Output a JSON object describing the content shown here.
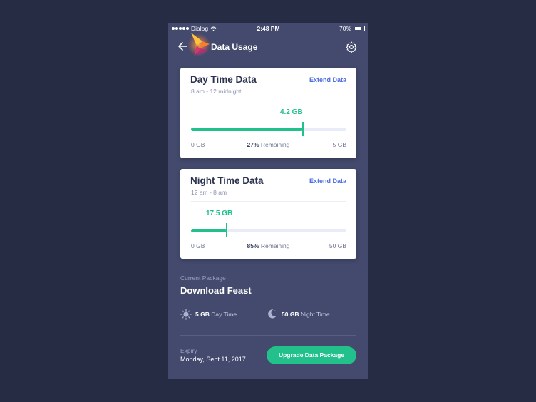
{
  "status_bar": {
    "carrier": "Dialog",
    "time": "2:48 PM",
    "battery": "70%"
  },
  "header": {
    "title": "Data Usage"
  },
  "day_card": {
    "title": "Day Time Data",
    "hours": "8 am - 12 midnight",
    "extend_label": "Extend Data",
    "used": "4.2 GB",
    "used_fraction": 0.72,
    "min_label": "0 GB",
    "remaining_pct": "27%",
    "remaining_word": "Remaining",
    "max_label": "5 GB"
  },
  "night_card": {
    "title": "Night Time Data",
    "hours": "12 am - 8 am",
    "extend_label": "Extend Data",
    "used": "17.5 GB",
    "used_fraction": 0.23,
    "min_label": "0 GB",
    "remaining_pct": "85%",
    "remaining_word": "Remaining",
    "max_label": "50 GB"
  },
  "package": {
    "label": "Current Package",
    "name": "Download Feast",
    "day_amount": "5 GB",
    "day_text": "Day Time",
    "night_amount": "50 GB",
    "night_text": "Night Time"
  },
  "expiry": {
    "label": "Expiry",
    "date": "Monday, Sept 11, 2017"
  },
  "actions": {
    "upgrade_label": "Upgrade Data Package"
  },
  "colors": {
    "accent_green": "#22c18b",
    "link_blue": "#4b6de0",
    "panel": "#434a6d",
    "background": "#272c45"
  }
}
